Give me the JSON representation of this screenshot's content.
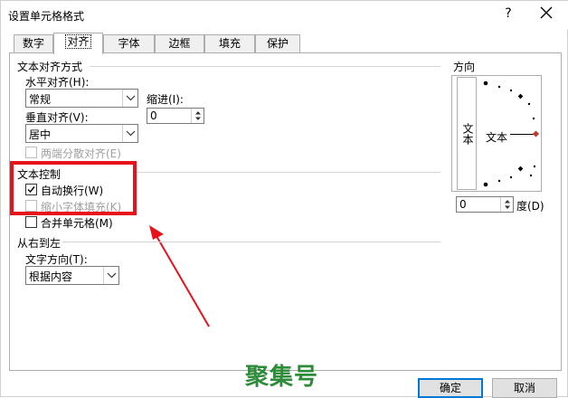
{
  "window": {
    "title": "设置单元格格式",
    "help_glyph": "?"
  },
  "tabs": [
    {
      "label": "数字"
    },
    {
      "label": "对齐"
    },
    {
      "label": "字体"
    },
    {
      "label": "边框"
    },
    {
      "label": "填充"
    },
    {
      "label": "保护"
    }
  ],
  "alignment": {
    "section_title": "文本对齐方式",
    "horizontal_label": "水平对齐(H):",
    "horizontal_value": "常规",
    "indent_label": "缩进(I):",
    "indent_value": "0",
    "vertical_label": "垂直对齐(V):",
    "vertical_value": "居中",
    "distributed_label": "两端分散对齐(E)"
  },
  "text_control": {
    "section_title": "文本控制",
    "wrap_text_label": "自动换行(W)",
    "wrap_text_checked": true,
    "shrink_label": "缩小字体填充(K)",
    "merge_label": "合并单元格(M)"
  },
  "rtl": {
    "section_title": "从右到左",
    "direction_label": "文字方向(T):",
    "direction_value": "根据内容"
  },
  "orientation": {
    "section_title": "方向",
    "vertical_text": "文本",
    "dial_text": "文本",
    "degrees_value": "0",
    "degrees_label": "度(D)"
  },
  "buttons": {
    "ok": "确定",
    "cancel": "取消"
  },
  "watermark": {
    "text": "聚集号"
  },
  "colors": {
    "annotation_red": "#e8121c",
    "dial_marker": "#c0392b",
    "watermark_green": "#2e8b3a"
  }
}
